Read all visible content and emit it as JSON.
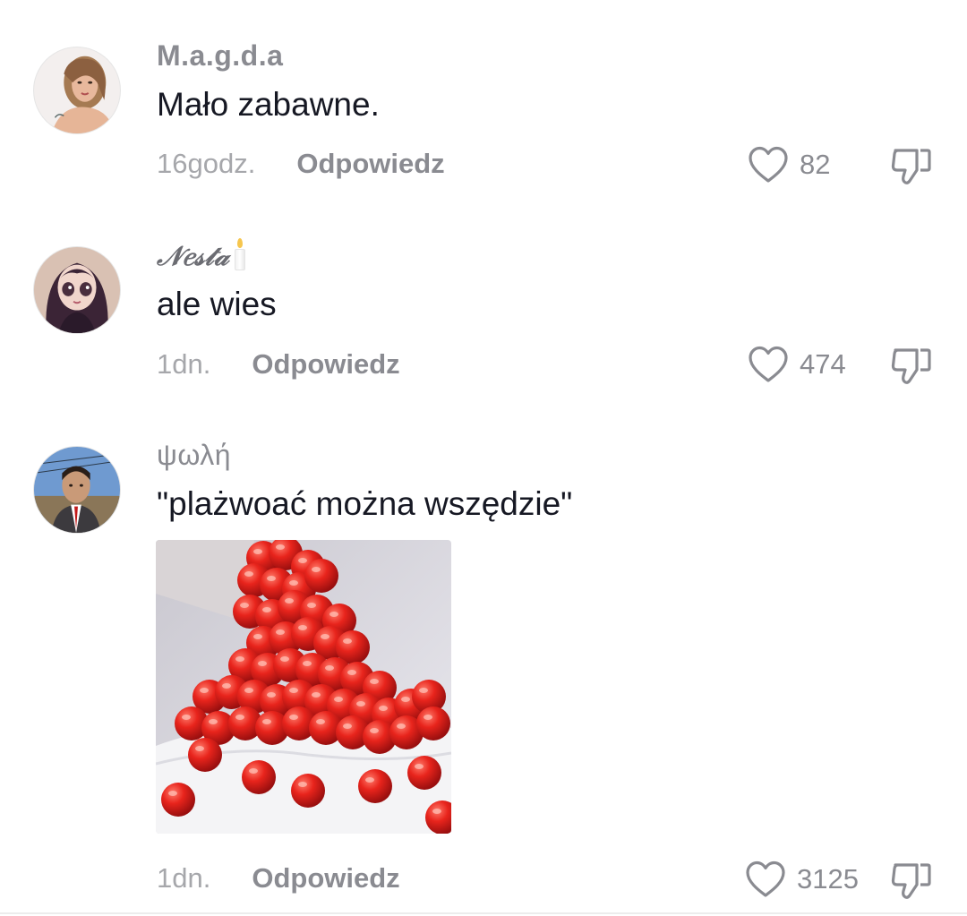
{
  "comments": [
    {
      "username": "M.a.g.d.a",
      "text": "Mało zabawne.",
      "time": "16godz.",
      "reply_label": "Odpowiedz",
      "likes": "82"
    },
    {
      "username": "𝒩𝑒𝓈𝓉𝒶",
      "text": "ale wies",
      "time": "1dn.",
      "reply_label": "Odpowiedz",
      "likes": "474"
    },
    {
      "username": "ψωλή",
      "text": "\"plażwoać można wszędzie\"",
      "time": "1dn.",
      "reply_label": "Odpowiedz",
      "likes": "3125",
      "attachment_icon": "cherries-falling-on-cake-image"
    }
  ],
  "icons": {
    "like": "heart-outline-icon",
    "dislike": "thumbs-down-icon",
    "candle": "candle-emoji"
  },
  "colors": {
    "username": "#8a8b91",
    "text": "#161823",
    "meta": "#a6a7ab"
  }
}
